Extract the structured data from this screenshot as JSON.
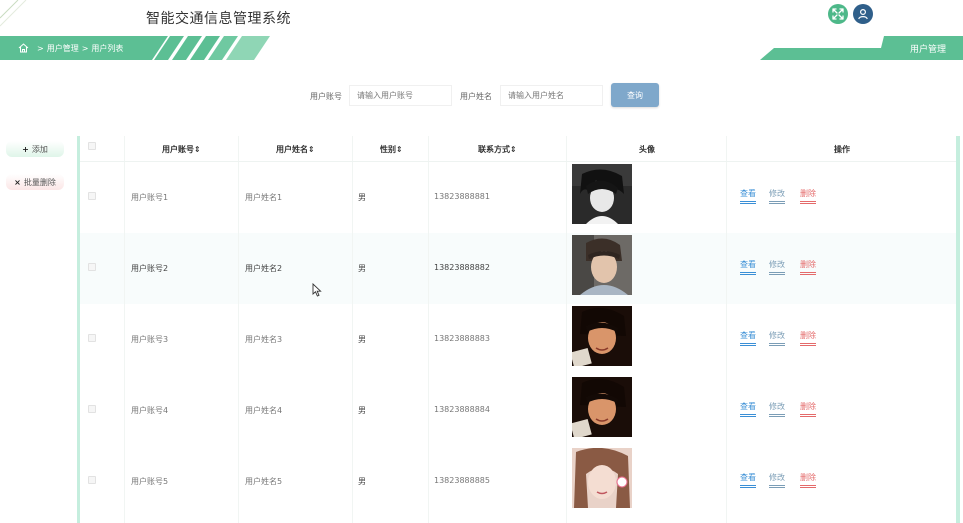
{
  "header": {
    "app_title": "智能交通信息管理系统",
    "fullscreen_icon": "expand-arrows-icon",
    "user_icon": "user-icon"
  },
  "breadcrumb": {
    "home_icon": "home-icon",
    "sep": ">",
    "items": [
      "用户管理",
      "用户列表"
    ]
  },
  "right_tab": {
    "label": "用户管理"
  },
  "search": {
    "account_label": "用户账号",
    "account_placeholder": "请输入用户账号",
    "name_label": "用户姓名",
    "name_placeholder": "请输入用户姓名",
    "button_label": "查询"
  },
  "side_buttons": {
    "add_label": "添加",
    "add_icon": "+",
    "batch_delete_label": "批量删除",
    "batch_delete_icon": "×"
  },
  "table": {
    "columns": {
      "account": "用户账号",
      "name": "用户姓名",
      "gender": "性别",
      "contact": "联系方式",
      "avatar": "头像",
      "actions": "操作"
    },
    "sort_icon": "⇕",
    "action_labels": {
      "view": "查看",
      "edit": "修改",
      "delete": "删除"
    },
    "rows": [
      {
        "account": "用户账号1",
        "name": "用户姓名1",
        "gender": "男",
        "contact": "13823888881",
        "avatar": "avatar-1"
      },
      {
        "account": "用户账号2",
        "name": "用户姓名2",
        "gender": "男",
        "contact": "13823888882",
        "avatar": "avatar-2"
      },
      {
        "account": "用户账号3",
        "name": "用户姓名3",
        "gender": "男",
        "contact": "13823888883",
        "avatar": "avatar-3"
      },
      {
        "account": "用户账号4",
        "name": "用户姓名4",
        "gender": "男",
        "contact": "13823888884",
        "avatar": "avatar-4"
      },
      {
        "account": "用户账号5",
        "name": "用户姓名5",
        "gender": "男",
        "contact": "13823888885",
        "avatar": "avatar-5"
      }
    ]
  },
  "colors": {
    "accent_green": "#5cbf94",
    "search_button": "#7fa8cb",
    "view_link": "#3a8fd6",
    "edit_link": "#7b9db6",
    "delete_link": "#e46a6a"
  }
}
